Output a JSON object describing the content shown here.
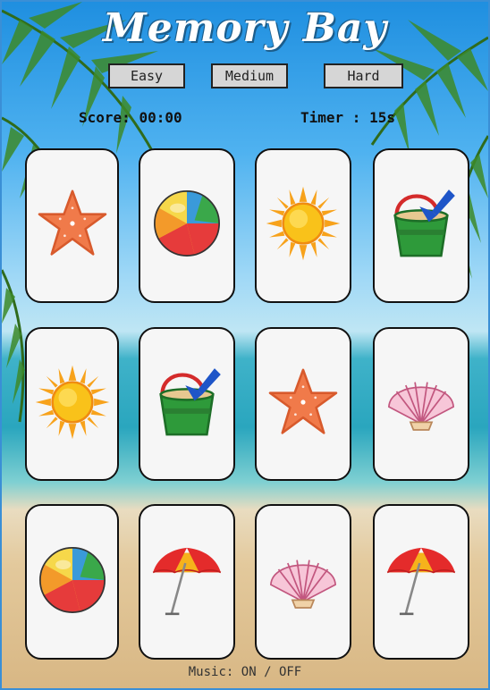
{
  "title": "Memory Bay",
  "levels": {
    "easy": "Easy",
    "medium": "Medium",
    "hard": "Hard"
  },
  "score": {
    "label": "Score:",
    "value": "00:00"
  },
  "timer": {
    "label": "Timer :",
    "value": "15s"
  },
  "cards": [
    {
      "icon": "starfish-icon"
    },
    {
      "icon": "beach-ball-icon"
    },
    {
      "icon": "sun-icon"
    },
    {
      "icon": "sand-bucket-icon"
    },
    {
      "icon": "sun-icon"
    },
    {
      "icon": "sand-bucket-icon"
    },
    {
      "icon": "starfish-icon"
    },
    {
      "icon": "seashell-icon"
    },
    {
      "icon": "beach-ball-icon"
    },
    {
      "icon": "beach-umbrella-icon"
    },
    {
      "icon": "seashell-icon"
    },
    {
      "icon": "beach-umbrella-icon"
    }
  ],
  "music": {
    "label": "Music:",
    "on": "ON",
    "separator": "/",
    "off": "OFF"
  }
}
